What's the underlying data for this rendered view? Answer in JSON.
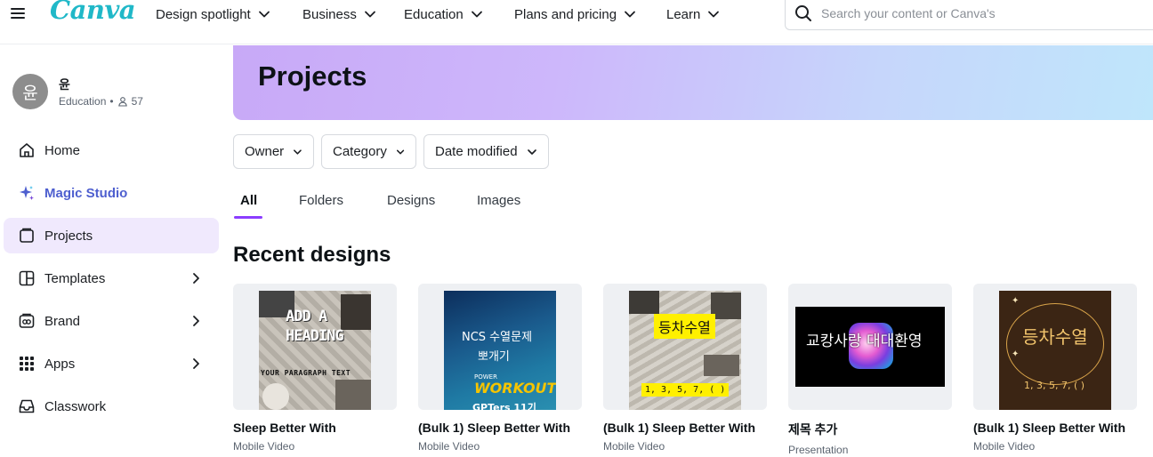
{
  "nav": {
    "logo": "Canva",
    "items": [
      {
        "label": "Design spotlight"
      },
      {
        "label": "Business"
      },
      {
        "label": "Education"
      },
      {
        "label": "Plans and pricing"
      },
      {
        "label": "Learn"
      }
    ],
    "search_placeholder": "Search your content or Canva's"
  },
  "sidebar": {
    "avatar_initial": "윤",
    "user_name": "윤",
    "user_plan": "Education",
    "separator": "•",
    "member_count": "57",
    "items": [
      {
        "label": "Home",
        "icon": "home-icon"
      },
      {
        "label": "Magic Studio",
        "icon": "sparkle-icon"
      },
      {
        "label": "Projects",
        "icon": "folder-icon",
        "active": true
      },
      {
        "label": "Templates",
        "icon": "templates-icon"
      },
      {
        "label": "Brand",
        "icon": "brand-icon"
      },
      {
        "label": "Apps",
        "icon": "apps-grid-icon"
      },
      {
        "label": "Classwork",
        "icon": "inbox-icon"
      }
    ]
  },
  "main": {
    "page_title": "Projects",
    "filters": [
      {
        "label": "Owner"
      },
      {
        "label": "Category"
      },
      {
        "label": "Date modified"
      }
    ],
    "tabs": [
      {
        "label": "All",
        "active": true
      },
      {
        "label": "Folders"
      },
      {
        "label": "Designs"
      },
      {
        "label": "Images"
      }
    ],
    "section_title": "Recent designs",
    "designs": [
      {
        "title": "Sleep Better With",
        "type": "Mobile Video",
        "thumb_text_1": "ADD A",
        "thumb_text_2": "HEADING",
        "thumb_text_3": "YOUR PARAGRAPH TEXT"
      },
      {
        "title": "(Bulk 1) Sleep Better With",
        "type": "Mobile Video",
        "thumb_text_1": "NCS 수열문제",
        "thumb_text_2": "뽀개기",
        "thumb_text_3": "POWER",
        "thumb_text_4": "WORKOUT",
        "thumb_text_5": "GPTers 11기"
      },
      {
        "title": "(Bulk 1) Sleep Better With",
        "type": "Mobile Video",
        "thumb_text_1": "등차수열",
        "thumb_text_2": "1, 3, 5, 7, ( )"
      },
      {
        "title": "제목 추가",
        "type": "Presentation",
        "thumb_text_1": "교캉사랑 대대환영"
      },
      {
        "title": "(Bulk 1) Sleep Better With",
        "type": "Mobile Video",
        "thumb_text_1": "등차수열",
        "thumb_text_2": "1, 3, 5, 7, ( )"
      }
    ]
  },
  "colors": {
    "accent": "#8b3dff",
    "active_bg": "#f0e9fd",
    "magic_studio": "#4e5fcf",
    "logo": "#20b8c8"
  }
}
